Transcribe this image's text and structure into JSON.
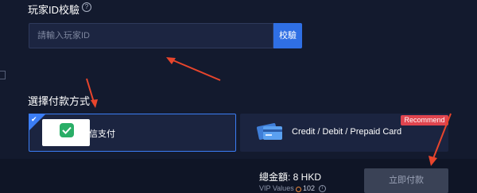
{
  "player_id_section": {
    "title": "玩家ID校驗",
    "help_icon": "question-circle-icon",
    "input": {
      "placeholder": "請輸入玩家ID",
      "value": ""
    },
    "verify_button_label": "校驗"
  },
  "payment_section": {
    "title": "選擇付款方式",
    "methods": [
      {
        "label": "微信支付",
        "icon": "wechat-pay-icon",
        "selected": true
      },
      {
        "label": "Credit / Debit / Prepaid Card",
        "icon": "credit-card-icon",
        "selected": false,
        "badge": "Recommend"
      }
    ]
  },
  "footer": {
    "total_label": "總金額: 8 HKD",
    "vip_label": "VIP Values",
    "vip_value": "102",
    "pay_button_label": "立即付款"
  },
  "colors": {
    "background": "#131a2e",
    "accent": "#2f6fe4",
    "recommend_badge": "#e0454f",
    "annotation_arrows": "#e8452c"
  }
}
